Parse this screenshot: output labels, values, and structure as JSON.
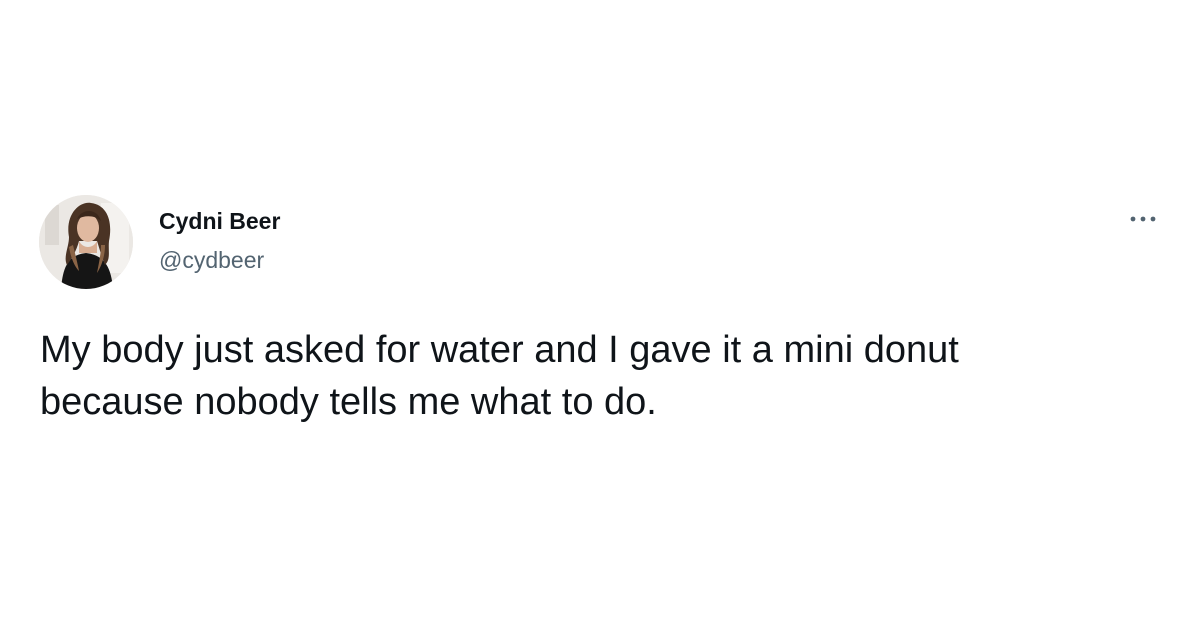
{
  "tweet": {
    "author": {
      "name": "Cydni Beer",
      "handle": "@cydbeer",
      "avatar_icon": "profile-photo-avatar"
    },
    "more_icon": "more-options-icon",
    "text_lines": [
      "My body just asked for water and I gave it a mini donut",
      "because nobody tells me what to do."
    ]
  },
  "colors": {
    "background": "#ffffff",
    "primary_text": "#0f1419",
    "secondary_text": "#536471"
  }
}
